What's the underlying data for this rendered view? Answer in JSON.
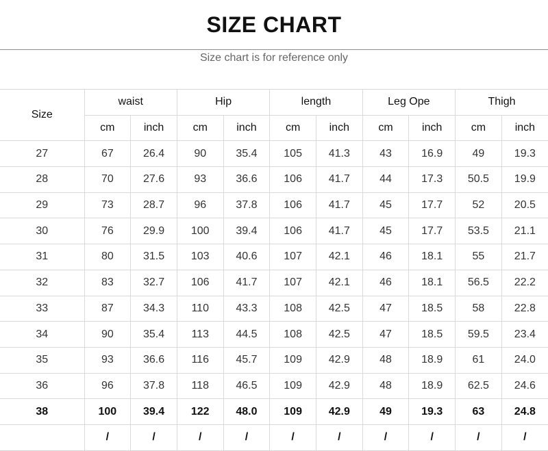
{
  "title": "SIZE CHART",
  "subtitle": "Size chart is for reference only",
  "table": {
    "size_header": "Size",
    "groups": [
      "waist",
      "Hip",
      "length",
      "Leg Ope",
      "Thigh"
    ],
    "units": [
      "cm",
      "inch",
      "cm",
      "inch",
      "cm",
      "inch",
      "cm",
      "inch",
      "cm",
      "inch"
    ],
    "rows": [
      [
        "27",
        "67",
        "26.4",
        "90",
        "35.4",
        "105",
        "41.3",
        "43",
        "16.9",
        "49",
        "19.3"
      ],
      [
        "28",
        "70",
        "27.6",
        "93",
        "36.6",
        "106",
        "41.7",
        "44",
        "17.3",
        "50.5",
        "19.9"
      ],
      [
        "29",
        "73",
        "28.7",
        "96",
        "37.8",
        "106",
        "41.7",
        "45",
        "17.7",
        "52",
        "20.5"
      ],
      [
        "30",
        "76",
        "29.9",
        "100",
        "39.4",
        "106",
        "41.7",
        "45",
        "17.7",
        "53.5",
        "21.1"
      ],
      [
        "31",
        "80",
        "31.5",
        "103",
        "40.6",
        "107",
        "42.1",
        "46",
        "18.1",
        "55",
        "21.7"
      ],
      [
        "32",
        "83",
        "32.7",
        "106",
        "41.7",
        "107",
        "42.1",
        "46",
        "18.1",
        "56.5",
        "22.2"
      ],
      [
        "33",
        "87",
        "34.3",
        "110",
        "43.3",
        "108",
        "42.5",
        "47",
        "18.5",
        "58",
        "22.8"
      ],
      [
        "34",
        "90",
        "35.4",
        "113",
        "44.5",
        "108",
        "42.5",
        "47",
        "18.5",
        "59.5",
        "23.4"
      ],
      [
        "35",
        "93",
        "36.6",
        "116",
        "45.7",
        "109",
        "42.9",
        "48",
        "18.9",
        "61",
        "24.0"
      ],
      [
        "36",
        "96",
        "37.8",
        "118",
        "46.5",
        "109",
        "42.9",
        "48",
        "18.9",
        "62.5",
        "24.6"
      ],
      [
        "38",
        "100",
        "39.4",
        "122",
        "48.0",
        "109",
        "42.9",
        "49",
        "19.3",
        "63",
        "24.8"
      ],
      [
        "",
        "/",
        "/",
        "/",
        "/",
        "/",
        "/",
        "/",
        "/",
        "/",
        "/"
      ]
    ]
  }
}
